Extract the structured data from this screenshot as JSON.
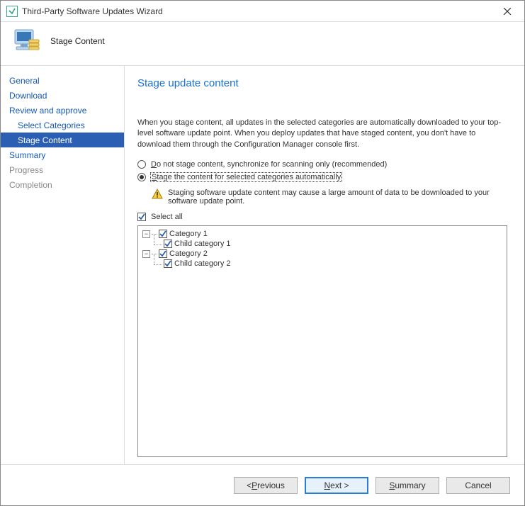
{
  "window": {
    "title": "Third-Party Software Updates Wizard"
  },
  "header": {
    "subtitle": "Stage Content"
  },
  "sidebar": {
    "items": [
      {
        "label": "General",
        "kind": "top"
      },
      {
        "label": "Download",
        "kind": "top"
      },
      {
        "label": "Review and approve",
        "kind": "top"
      },
      {
        "label": "Select Categories",
        "kind": "child"
      },
      {
        "label": "Stage Content",
        "kind": "child-active"
      },
      {
        "label": "Summary",
        "kind": "top"
      },
      {
        "label": "Progress",
        "kind": "disabled"
      },
      {
        "label": "Completion",
        "kind": "disabled"
      }
    ]
  },
  "content": {
    "heading": "Stage update content",
    "description": "When you stage content, all updates in the selected categories are automatically downloaded to your top-level software update point. When you deploy updates that have staged content, you don't have to download them through the Configuration Manager console first.",
    "radios": {
      "opt1_prefix": "D",
      "opt1_rest": "o not stage content, synchronize for scanning only (recommended)",
      "opt2_prefix": "S",
      "opt2_rest": "tage the content for selected categories automatically",
      "selected": 1
    },
    "warning": "Staging software update content may cause a large amount of data to be downloaded to your software update point.",
    "select_all_prefix": "S",
    "select_all_rest": "elect all",
    "tree": [
      {
        "label": "Category 1",
        "level": 0,
        "expanded": true,
        "checked": true
      },
      {
        "label": "Child category 1",
        "level": 1,
        "expanded": null,
        "checked": true
      },
      {
        "label": "Category 2",
        "level": 0,
        "expanded": true,
        "checked": true
      },
      {
        "label": "Child category 2",
        "level": 1,
        "expanded": null,
        "checked": true
      }
    ]
  },
  "footer": {
    "previous_prefix": "< ",
    "previous_u": "P",
    "previous_rest": "revious",
    "next_u": "N",
    "next_rest": "ext >",
    "summary_u": "S",
    "summary_rest": "ummary",
    "cancel": "Cancel"
  }
}
